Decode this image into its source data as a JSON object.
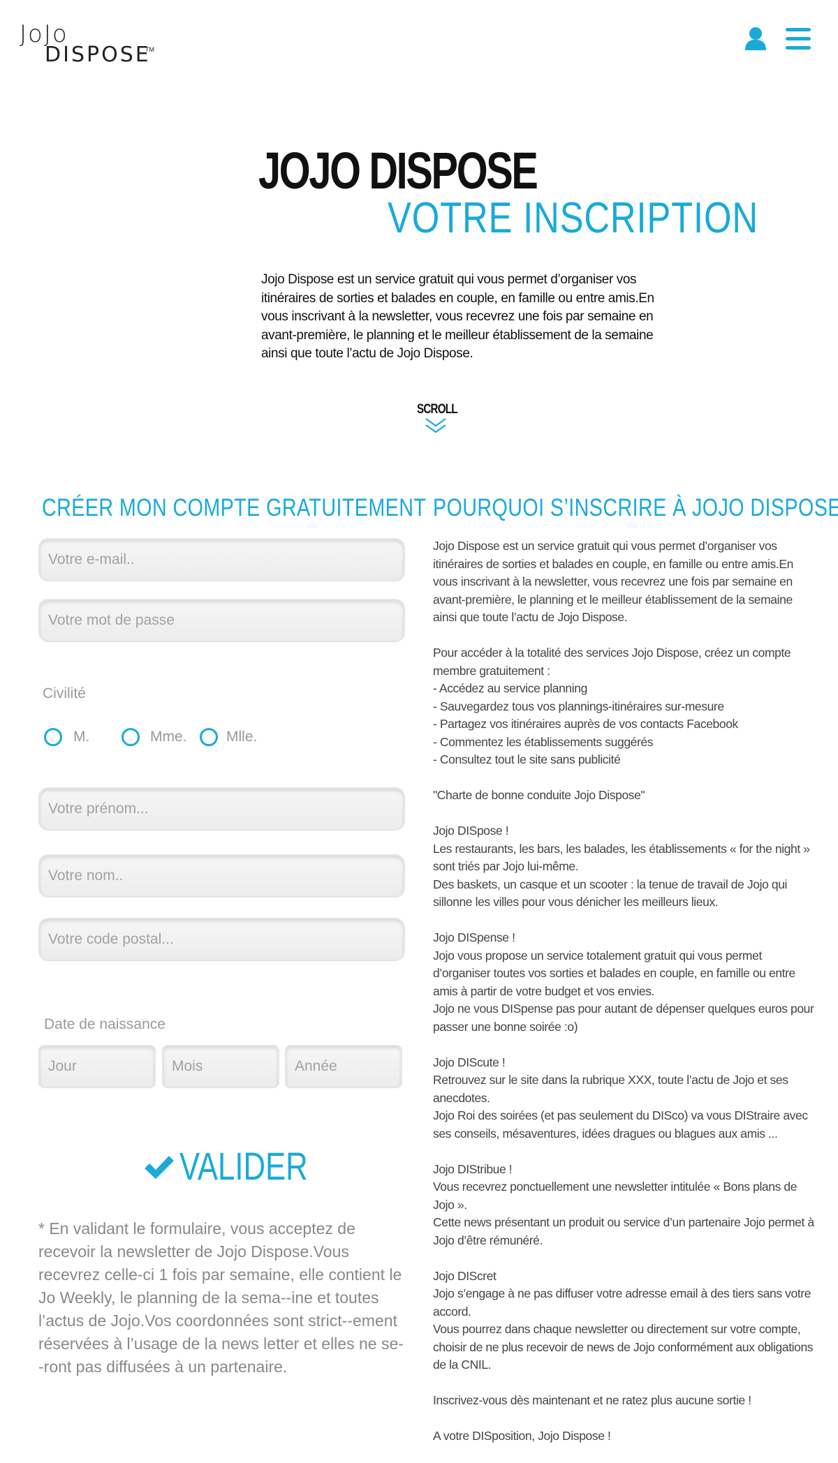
{
  "header": {
    "logo_top": "JoJo",
    "logo_bottom": "DISPOSE",
    "logo_tm": "TM",
    "user_icon": "user-icon",
    "menu_icon": "hamburger-menu-icon"
  },
  "hero": {
    "title": "JOJO DISPOSE",
    "subtitle": "VOTRE INSCRIPTION",
    "intro": "Jojo Dispose est un service gratuit qui vous permet d’organiser vos itinéraires de sorties et balades en couple, en famille ou entre amis.En vous inscrivant à la newsletter, vous recevrez une fois par semaine en avant-première, le planning et le meilleur établissement de la semaine ainsi que toute l’actu de Jojo Dispose.",
    "scroll_label": "SCROLL"
  },
  "form": {
    "title": "CRÉER MON COMPTE GRATUITEMENT",
    "email_placeholder": "Votre e-mail..",
    "password_placeholder": "Votre mot de passe",
    "civility_label": "Civilité",
    "civility_options": [
      "M.",
      "Mme.",
      "Mlle."
    ],
    "firstname_placeholder": "Votre prénom...",
    "lastname_placeholder": "Votre nom..",
    "postal_placeholder": "Votre code postal...",
    "birthdate_label": "Date de naissance",
    "day_placeholder": "Jour",
    "month_placeholder": "Mois",
    "year_placeholder": "Année",
    "submit_label": "VALIDER",
    "disclaimer": "* En validant le formulaire, vous acceptez de recevoir la newsletter de Jojo Dispose.Vous recevrez celle-ci 1 fois par semaine, elle contient le Jo Weekly, le planning de la sema--ine et toutes l’actus de Jojo.Vos coordonnées sont strict--ement réservées à l’usage de la news letter et elles ne se--ront pas diffusées à un partenaire."
  },
  "why": {
    "title": "POURQUOI S’INSCRIRE À JOJO DISPOSE",
    "paragraphs": [
      "Jojo Dispose est un service gratuit qui vous permet d’organiser vos itinéraires de sorties et balades en couple, en famille ou entre amis.En vous inscrivant à la newsletter, vous recevrez une fois par semaine en avant-première, le planning et le meilleur établissement de la semaine ainsi que toute l’actu de Jojo Dispose.",
      "Pour accéder à la totalité des services Jojo Dispose, créez un compte membre gratuitement :\n- Accédez au service planning\n- Sauvegardez tous vos plannings-itinéraires sur-mesure\n- Partagez vos itinéraires auprès de vos contacts Facebook\n- Commentez les établissements suggérés\n- Consultez tout le site sans publicité",
      "\"Charte de bonne conduite Jojo Dispose\"",
      "Jojo DISpose !\nLes restaurants, les bars, les balades, les établissements « for the night » sont triés par Jojo lui-même.\nDes baskets, un casque et un scooter : la tenue de travail de Jojo qui sillonne les villes pour vous dénicher les meilleurs lieux.",
      "Jojo DISpense !\nJojo vous propose un service totalement gratuit qui vous permet d’organiser toutes vos sorties et balades en couple, en famille ou entre amis à partir de votre budget et vos envies.\nJojo ne vous DISpense pas pour autant de dépenser quelques euros pour passer une bonne soirée :o)",
      "Jojo DIScute !\nRetrouvez sur le site dans la rubrique XXX, toute l’actu de Jojo et ses anecdotes.\nJojo Roi des soirées (et pas seulement du DISco) va vous DIStraire avec ses conseils, mésaventures, idées dragues ou blagues aux amis ...",
      "Jojo DIStribue !\nVous recevrez ponctuellement une newsletter intitulée « Bons plans de Jojo ».\nCette news présentant un produit ou service d’un partenaire Jojo permet à Jojo d’être rémunéré.",
      "Jojo DIScret\nJojo s’engage à ne pas diffuser votre adresse email à des tiers sans votre accord.\nVous pourrez dans chaque newsletter ou directement sur votre compte, choisir de ne plus recevoir de news de Jojo conformément aux obligations de la CNIL.",
      "Inscrivez-vous dès maintenant et ne ratez plus aucune sortie !",
      "A votre DISposition, Jojo Dispose !"
    ]
  },
  "colors": {
    "accent": "#19aad8",
    "text": "#111111",
    "muted": "#999999"
  }
}
